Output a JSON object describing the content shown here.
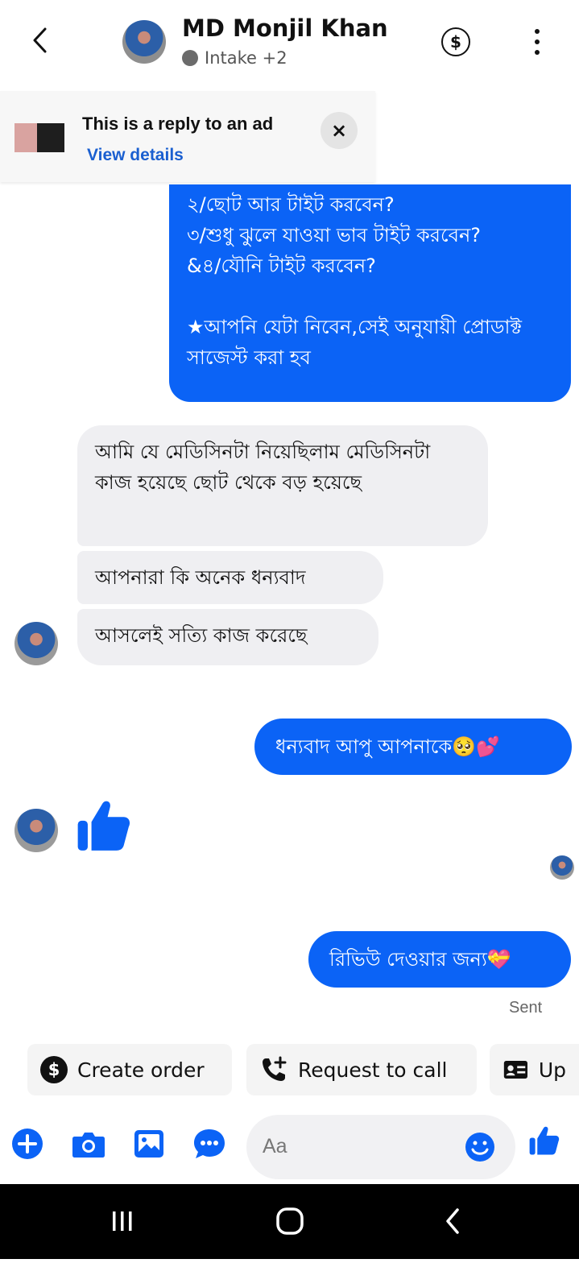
{
  "header": {
    "contact_name": "MD Monjil Khan",
    "status_label": "Intake +2"
  },
  "ad_reply": {
    "title": "This is a reply to an ad",
    "link": "View details",
    "close_symbol": "×"
  },
  "messages": [
    {
      "direction": "outgoing",
      "text": "২/ছোট আর টাইট করবেন?\n৩/শুধু ঝুলে যাওয়া ভাব টাইট করবেন?\n&৪/যৌনি টাইট করবেন?\n\n★আপনি যেটা নিবেন,সেই অনুযায়ী প্রোডাক্ট সাজেস্ট করা হব"
    },
    {
      "direction": "incoming",
      "text": "আমি যে মেডিসিনটা নিয়েছিলাম মেডিসিনটা কাজ হয়েছে ছোট থেকে বড় হয়েছে"
    },
    {
      "direction": "incoming",
      "text": "আপনারা কি অনেক ধন্যবাদ"
    },
    {
      "direction": "incoming",
      "text": "আসলেই সত্যি কাজ করেছে"
    },
    {
      "direction": "outgoing",
      "text": "ধন্যবাদ আপু আপনাকে🥺💕"
    },
    {
      "direction": "incoming",
      "type": "like",
      "icon": "thumbs-up-icon"
    },
    {
      "direction": "outgoing",
      "text": "রিভিউ দেওয়ার জন্য💝"
    }
  ],
  "delivery_status": "Sent",
  "quick_actions": [
    {
      "label": "Create order",
      "icon": "dollar-icon"
    },
    {
      "label": "Request to call",
      "icon": "phone-add-icon"
    },
    {
      "label": "Up",
      "icon": "contact-card-icon"
    }
  ],
  "composer": {
    "placeholder": "Aa",
    "icons": [
      "plus-icon",
      "camera-icon",
      "image-icon",
      "chat-dots-icon",
      "emoji-icon",
      "thumbs-up-icon"
    ]
  },
  "colors": {
    "accent": "#0b63f6",
    "incoming_bubble": "#efeff2",
    "link": "#1a5fd0"
  }
}
